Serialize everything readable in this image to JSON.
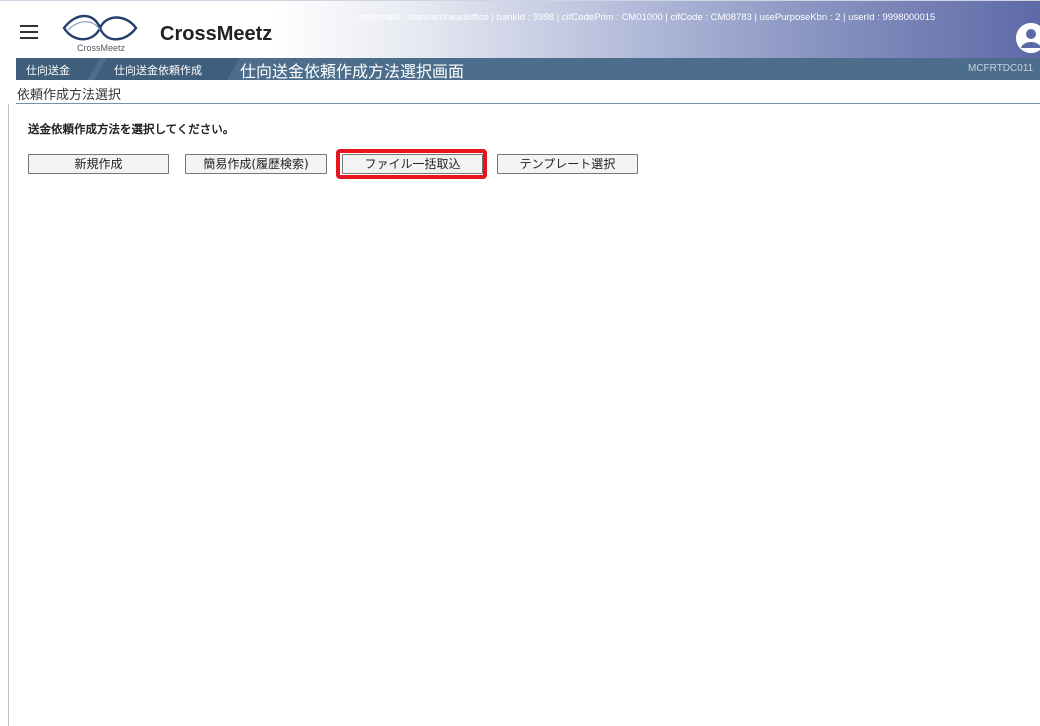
{
  "header": {
    "brand": "CrossMeetz",
    "logo_text": "CrossMeetz",
    "session_info": "| schemaId : standardheadoffice | bankId : 9998 | cifCodePrim : CM01000 | cifCode : CM08783 | usePurposeKbn : 2 | userId : 9998000015",
    "icons": {
      "menu": "hamburger-icon",
      "user": "user-avatar-icon"
    }
  },
  "breadcrumb": {
    "items": [
      "仕向送金",
      "仕向送金依頼作成"
    ],
    "title": "仕向送金依頼作成方法選択画面",
    "screen_id": "MCFRTDC011"
  },
  "section": {
    "title": "依頼作成方法選択",
    "instruction": "送金依頼作成方法を選択してください。"
  },
  "buttons": {
    "new": "新規作成",
    "simple": "簡易作成(履歴検索)",
    "file": "ファイル一括取込",
    "template": "テンプレート選択"
  },
  "colors": {
    "breadcrumb_bar": "#4c6e8c",
    "highlight": "#e8141c"
  }
}
